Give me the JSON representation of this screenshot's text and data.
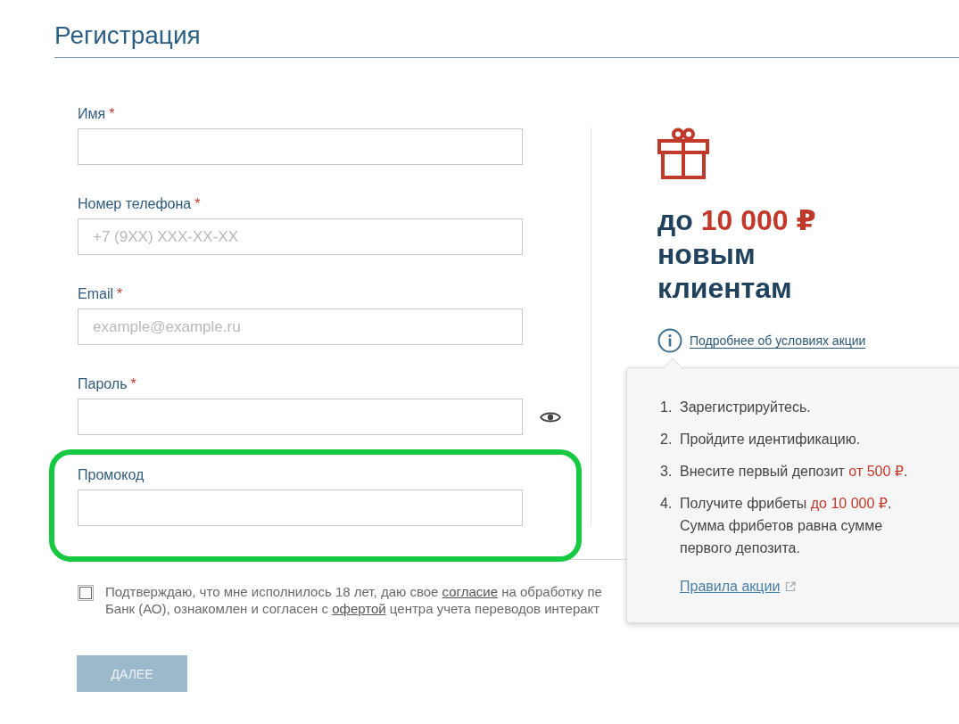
{
  "title": "Регистрация",
  "fields": [
    {
      "kind": "text",
      "label": "Имя",
      "required_mark": "*",
      "highlighted": false
    },
    {
      "kind": "text",
      "label": "Номер телефона",
      "required_mark": "*",
      "placeholder": "+7 (9XX) XXX-XX-XX",
      "highlighted": false
    },
    {
      "kind": "text",
      "label": "Email",
      "required_mark": "*",
      "placeholder": "example@example.ru",
      "highlighted": false
    },
    {
      "kind": "password",
      "label": "Пароль",
      "required_mark": "*",
      "highlighted": false
    },
    {
      "kind": "text",
      "label": "Промокод",
      "highlighted": true
    }
  ],
  "promo": {
    "headline": {
      "prefix": "до",
      "amount": "10 000 ₽",
      "rest": "новым клиентам"
    },
    "details_link": "Подробнее об условиях акции"
  },
  "popover": {
    "steps": [
      {
        "number": "1.",
        "text": "Зарегистрируйтесь."
      },
      {
        "number": "2.",
        "text": "Пройдите идентификацию."
      },
      {
        "number": "3.",
        "text": "Внесите первый депозит ",
        "highlight": "от 500 ₽",
        "after": "."
      },
      {
        "number": "4.",
        "text": "Получите фрибеты ",
        "highlight": "до 10 000 ₽",
        "after": ". Сумма фрибетов равна сумме первого депозита."
      }
    ],
    "rules_link": "Правила акции"
  },
  "consent": {
    "checked": false,
    "lines": [
      {
        "before": "Подтверждаю, что мне исполнилось 18 лет, даю свое ",
        "link": "согласие",
        "after": " на обработку пе"
      },
      {
        "before": "Банк (АО), ознакомлен и согласен с ",
        "link": "офертой",
        "after": " центра учета переводов интеракт"
      }
    ]
  },
  "button": {
    "label": "ДАЛЕЕ",
    "disabled": true
  }
}
